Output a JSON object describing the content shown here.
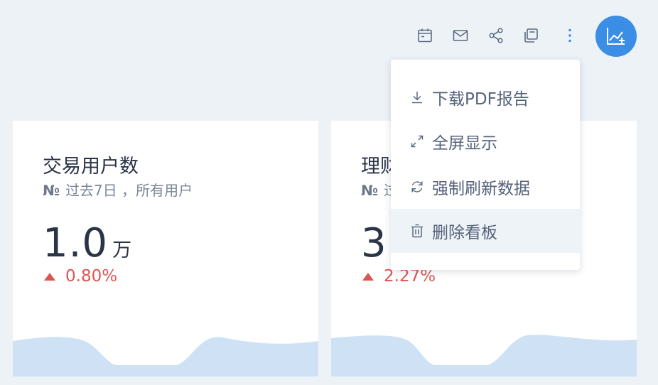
{
  "toolbar": {
    "icons": [
      "calendar-icon",
      "mail-icon",
      "share-icon",
      "copy-icon",
      "more-vertical-icon"
    ],
    "fab_icon": "add-chart-icon",
    "accent": "#3a8ee6"
  },
  "cards": [
    {
      "title": "交易用户数",
      "sub_prefix": "№",
      "sub_text": "过去7日 ，所有用户",
      "value": "1.0",
      "unit": "万",
      "change": "0.80%",
      "trend": "up"
    },
    {
      "title": "理财",
      "sub_prefix": "№",
      "sub_text": "过",
      "value": "3",
      "unit": "",
      "change": "2.27%",
      "trend": "up"
    }
  ],
  "menu": {
    "items": [
      {
        "label": "下载PDF报告",
        "icon": "download-icon"
      },
      {
        "label": "全屏显示",
        "icon": "fullscreen-icon"
      },
      {
        "label": "强制刷新数据",
        "icon": "refresh-icon"
      },
      {
        "label": "删除看板",
        "icon": "trash-icon",
        "highlighted": true
      }
    ]
  },
  "colors": {
    "background": "#edf2f7",
    "up_change": "#dd5552",
    "wave_fill": "#cfe2f5"
  }
}
